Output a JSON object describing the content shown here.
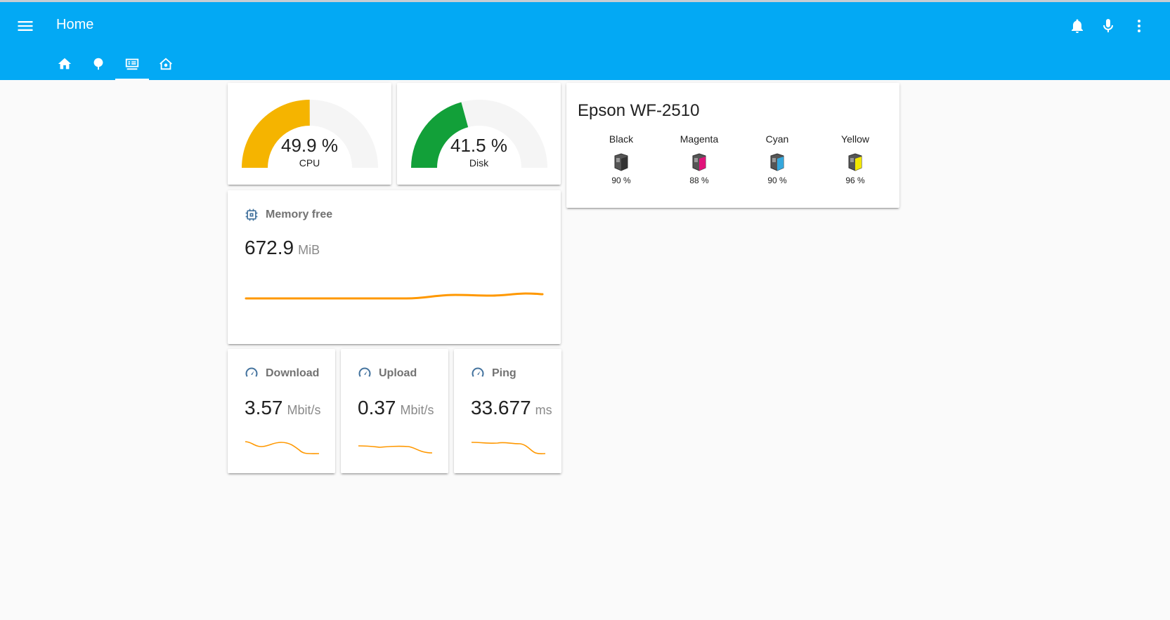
{
  "header": {
    "title": "Home",
    "icons": [
      "menu-icon",
      "bell-icon",
      "microphone-icon",
      "more-vert-icon"
    ]
  },
  "tabs": [
    {
      "icon": "home-icon",
      "active": false
    },
    {
      "icon": "tree-icon",
      "active": false
    },
    {
      "icon": "server-network-icon",
      "active": true
    },
    {
      "icon": "home-automation-icon",
      "active": false
    }
  ],
  "gauges": [
    {
      "value_text": "49.9 %",
      "label": "CPU",
      "value": 49.9,
      "color": "#f5b400"
    },
    {
      "value_text": "41.5 %",
      "label": "Disk",
      "value": 41.5,
      "color": "#12a039"
    }
  ],
  "printer": {
    "title": "Epson WF-2510",
    "inks": [
      {
        "name": "Black",
        "level": "90 %",
        "color": "#333333"
      },
      {
        "name": "Magenta",
        "level": "88 %",
        "color": "#e0137a"
      },
      {
        "name": "Cyan",
        "level": "90 %",
        "color": "#35a7dc"
      },
      {
        "name": "Yellow",
        "level": "96 %",
        "color": "#f2e600"
      }
    ]
  },
  "memory": {
    "name": "Memory free",
    "value": "672.9",
    "unit": "MiB",
    "icon": "memory-chip-icon"
  },
  "speedtest": [
    {
      "name": "Download",
      "value": "3.57",
      "unit": "Mbit/s",
      "icon": "speedometer-icon"
    },
    {
      "name": "Upload",
      "value": "0.37",
      "unit": "Mbit/s",
      "icon": "speedometer-icon"
    },
    {
      "name": "Ping",
      "value": "33.677",
      "unit": "ms",
      "icon": "speedometer-icon"
    }
  ],
  "colors": {
    "appbar": "#03a9f4",
    "sensor_line": "#ff9800",
    "sensor_icon": "#44739e"
  }
}
